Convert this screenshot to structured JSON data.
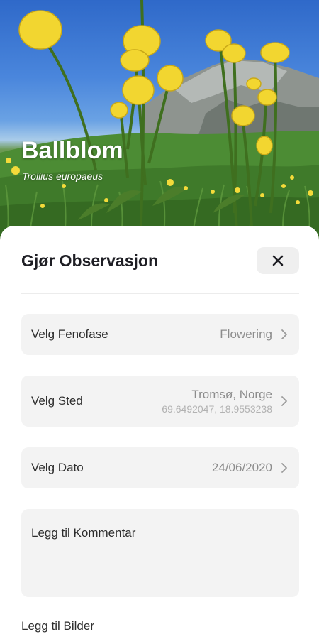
{
  "hero": {
    "common_name": "Ballblom",
    "latin_name": "Trollius europaeus"
  },
  "sheet": {
    "title": "Gjør Observasjon",
    "close_symbol": "✕"
  },
  "fields": {
    "phenophase": {
      "label": "Velg Fenofase",
      "value": "Flowering"
    },
    "location": {
      "label": "Velg Sted",
      "place": "Tromsø, Norge",
      "coordinates": "69.6492047, 18.9553238"
    },
    "date": {
      "label": "Velg Dato",
      "value": "24/06/2020"
    },
    "comment": {
      "placeholder": "Legg til Kommentar"
    },
    "images": {
      "label": "Legg til Bilder"
    }
  },
  "icons": {
    "close": "close-icon",
    "chevron": "chevron-right-icon"
  },
  "colors": {
    "flower_yellow": "#f2d630",
    "field_background": "#f3f3f3",
    "secondary_text": "#8c8c8c"
  }
}
